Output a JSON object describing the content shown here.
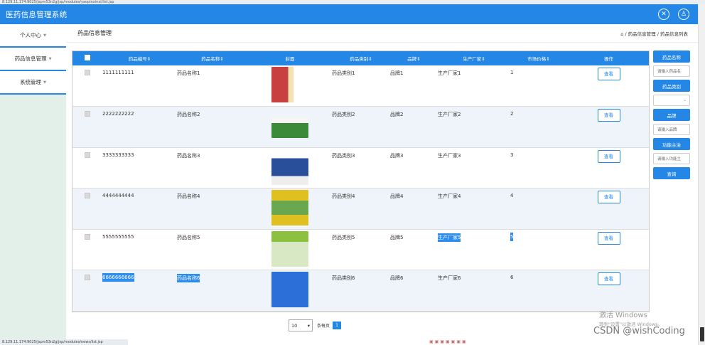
{
  "browser": {
    "url_top": "8.129.11.174:9025/jspm53n2g/jsp/modules/yaopinxinxi/list.jsp",
    "status_url": "8.129.11.174:9025/jspm53n2g/jsp/modules/news/list.jsp"
  },
  "header": {
    "title": "医药信息管理系统"
  },
  "sidebar": {
    "items": [
      {
        "label": "个人中心"
      },
      {
        "label": "药品信息管理"
      },
      {
        "label": "系统管理"
      }
    ]
  },
  "breadcrumb": {
    "title": "药品信息管理",
    "path": "⌂ / 药品信息管理 / 药品信息列表"
  },
  "table": {
    "columns": [
      "药品编号⇕",
      "药品名称⇕",
      "封面",
      "药品类别⇕",
      "品牌⇕",
      "生产厂家⇕",
      "市场价格⇕",
      "操作"
    ],
    "view_label": "查看",
    "rows": [
      {
        "id": "1111111111",
        "name": "药品名称1",
        "category": "药品类别1",
        "brand": "品牌1",
        "maker": "生产厂家1",
        "price": "1",
        "img_color": "#c84040"
      },
      {
        "id": "2222222222",
        "name": "药品名称2",
        "category": "药品类别2",
        "brand": "品牌2",
        "maker": "生产厂家2",
        "price": "2",
        "img_color": "#3a8a3a"
      },
      {
        "id": "3333333333",
        "name": "药品名称3",
        "category": "药品类别3",
        "brand": "品牌3",
        "maker": "生产厂家3",
        "price": "3",
        "img_color": "#2a4f9a"
      },
      {
        "id": "4444444444",
        "name": "药品名称4",
        "category": "药品类别4",
        "brand": "品牌4",
        "maker": "生产厂家4",
        "price": "4",
        "img_color": "#e0c020"
      },
      {
        "id": "5555555555",
        "name": "药品名称5",
        "category": "药品类别5",
        "brand": "品牌5",
        "maker": "生产厂家5",
        "price": "5",
        "img_color": "#8cc040"
      },
      {
        "id": "6666666666",
        "name": "药品名称6",
        "category": "药品类别6",
        "brand": "品牌6",
        "maker": "生产厂家6",
        "price": "6",
        "img_color": "#2d6fd8"
      }
    ]
  },
  "search": {
    "name_label": "药品名称",
    "name_placeholder": "请输入药品名",
    "category_label": "药品类别",
    "brand_label": "品牌",
    "brand_placeholder": "请输入品牌",
    "function_label": "功能主治",
    "function_placeholder": "请输入功能主",
    "query_button": "查询"
  },
  "pagination": {
    "page_size": "10",
    "page_size_suffix": "条每页",
    "current_page": "1"
  },
  "watermarks": {
    "windows_line1": "激活 Windows",
    "windows_line2": "转到\"设置\"以激活 Windows。",
    "csdn": "CSDN @wishCoding"
  },
  "colors": {
    "primary": "#2487e6",
    "sidebar_bg": "#e3f0ea",
    "row_alt": "#eef4f9"
  }
}
